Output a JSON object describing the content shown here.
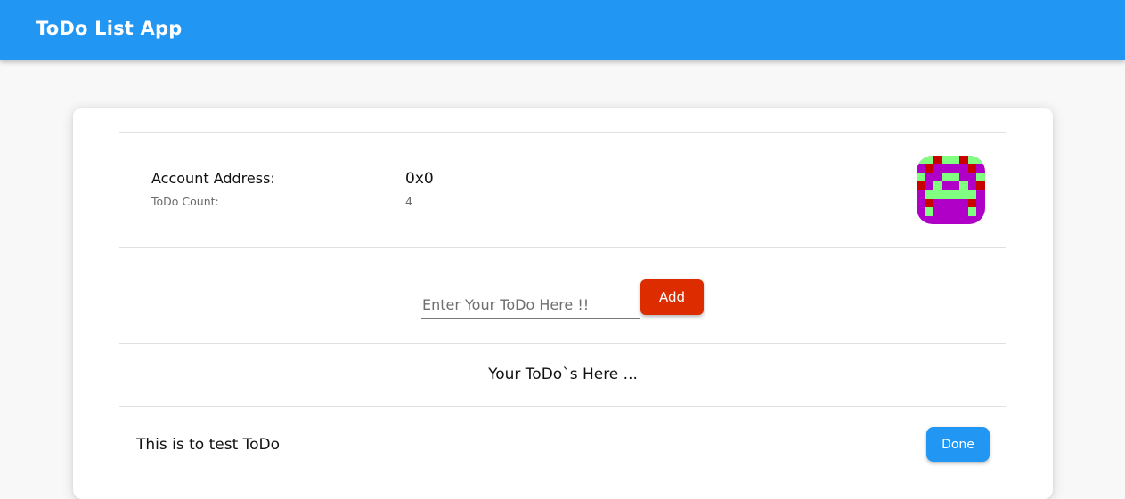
{
  "appbar": {
    "title": "ToDo List App"
  },
  "account": {
    "address_label": "Account Address:",
    "address_value": "0x0",
    "count_label": "ToDo Count:",
    "count_value": "4",
    "avatar": "identicon-avatar"
  },
  "new_todo": {
    "placeholder": "Enter Your ToDo Here !!",
    "value": "",
    "add_label": "Add"
  },
  "todos_heading": "Your ToDo`s Here ...",
  "todos": [
    {
      "text": "This is to test ToDo",
      "done_label": "Done"
    }
  ],
  "colors": {
    "primary": "#2196f3",
    "accent": "#dd2c00",
    "identicon_bg": "#b000c8",
    "identicon_green": "#80ff80",
    "identicon_red": "#c80000"
  }
}
